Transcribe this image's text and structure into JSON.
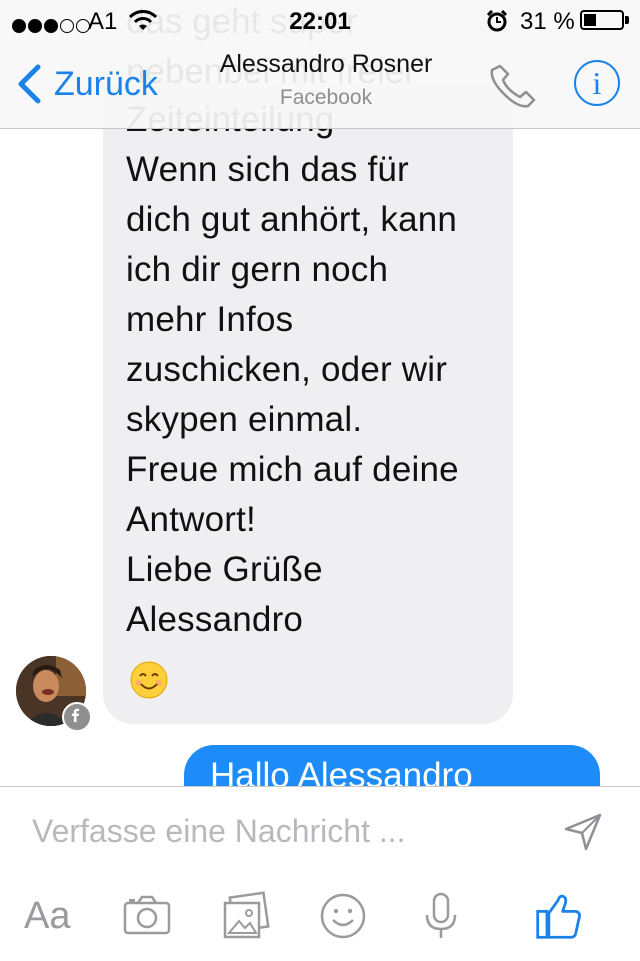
{
  "status_bar": {
    "carrier": "A1",
    "time": "22:01",
    "battery_percent": "31 %",
    "battery_level": 0.31,
    "signal_bars": 3,
    "icons": [
      "signal-dots-icon",
      "wifi-icon",
      "alarm-icon",
      "battery-icon"
    ]
  },
  "nav": {
    "back_label": "Zurück",
    "contact_name": "Alessandro Rosner",
    "contact_source": "Facebook",
    "icons": [
      "chevron-left-icon",
      "phone-icon",
      "info-icon"
    ],
    "accent_color": "#1a82e8"
  },
  "chat": {
    "ghost_lines": [
      "das geht super",
      "nebenbei mit freier",
      "Zeiteinteilung"
    ],
    "incoming_message": {
      "lines": [
        "Wenn sich das für",
        "dich gut anhört, kann",
        "ich dir gern noch",
        "mehr Infos",
        "zuschicken, oder wir",
        "skypen einmal.",
        "Freue mich auf deine",
        "Antwort!",
        "Liebe Grüße",
        "Alessandro"
      ],
      "emoji": "😊",
      "bubble_color": "#efeef1"
    },
    "sender_avatar_badge": "facebook-icon",
    "outgoing_message": {
      "text": "Hallo Alessandro",
      "bubble_color": "#1d8cf8"
    }
  },
  "composer": {
    "placeholder": "Verfasse eine Nachricht ...",
    "toolbar": {
      "text_format_label": "Aa",
      "icons": [
        "camera-icon",
        "gallery-icon",
        "emoji-icon",
        "microphone-icon",
        "like-thumb-icon"
      ]
    },
    "like_color": "#1a82e8"
  }
}
